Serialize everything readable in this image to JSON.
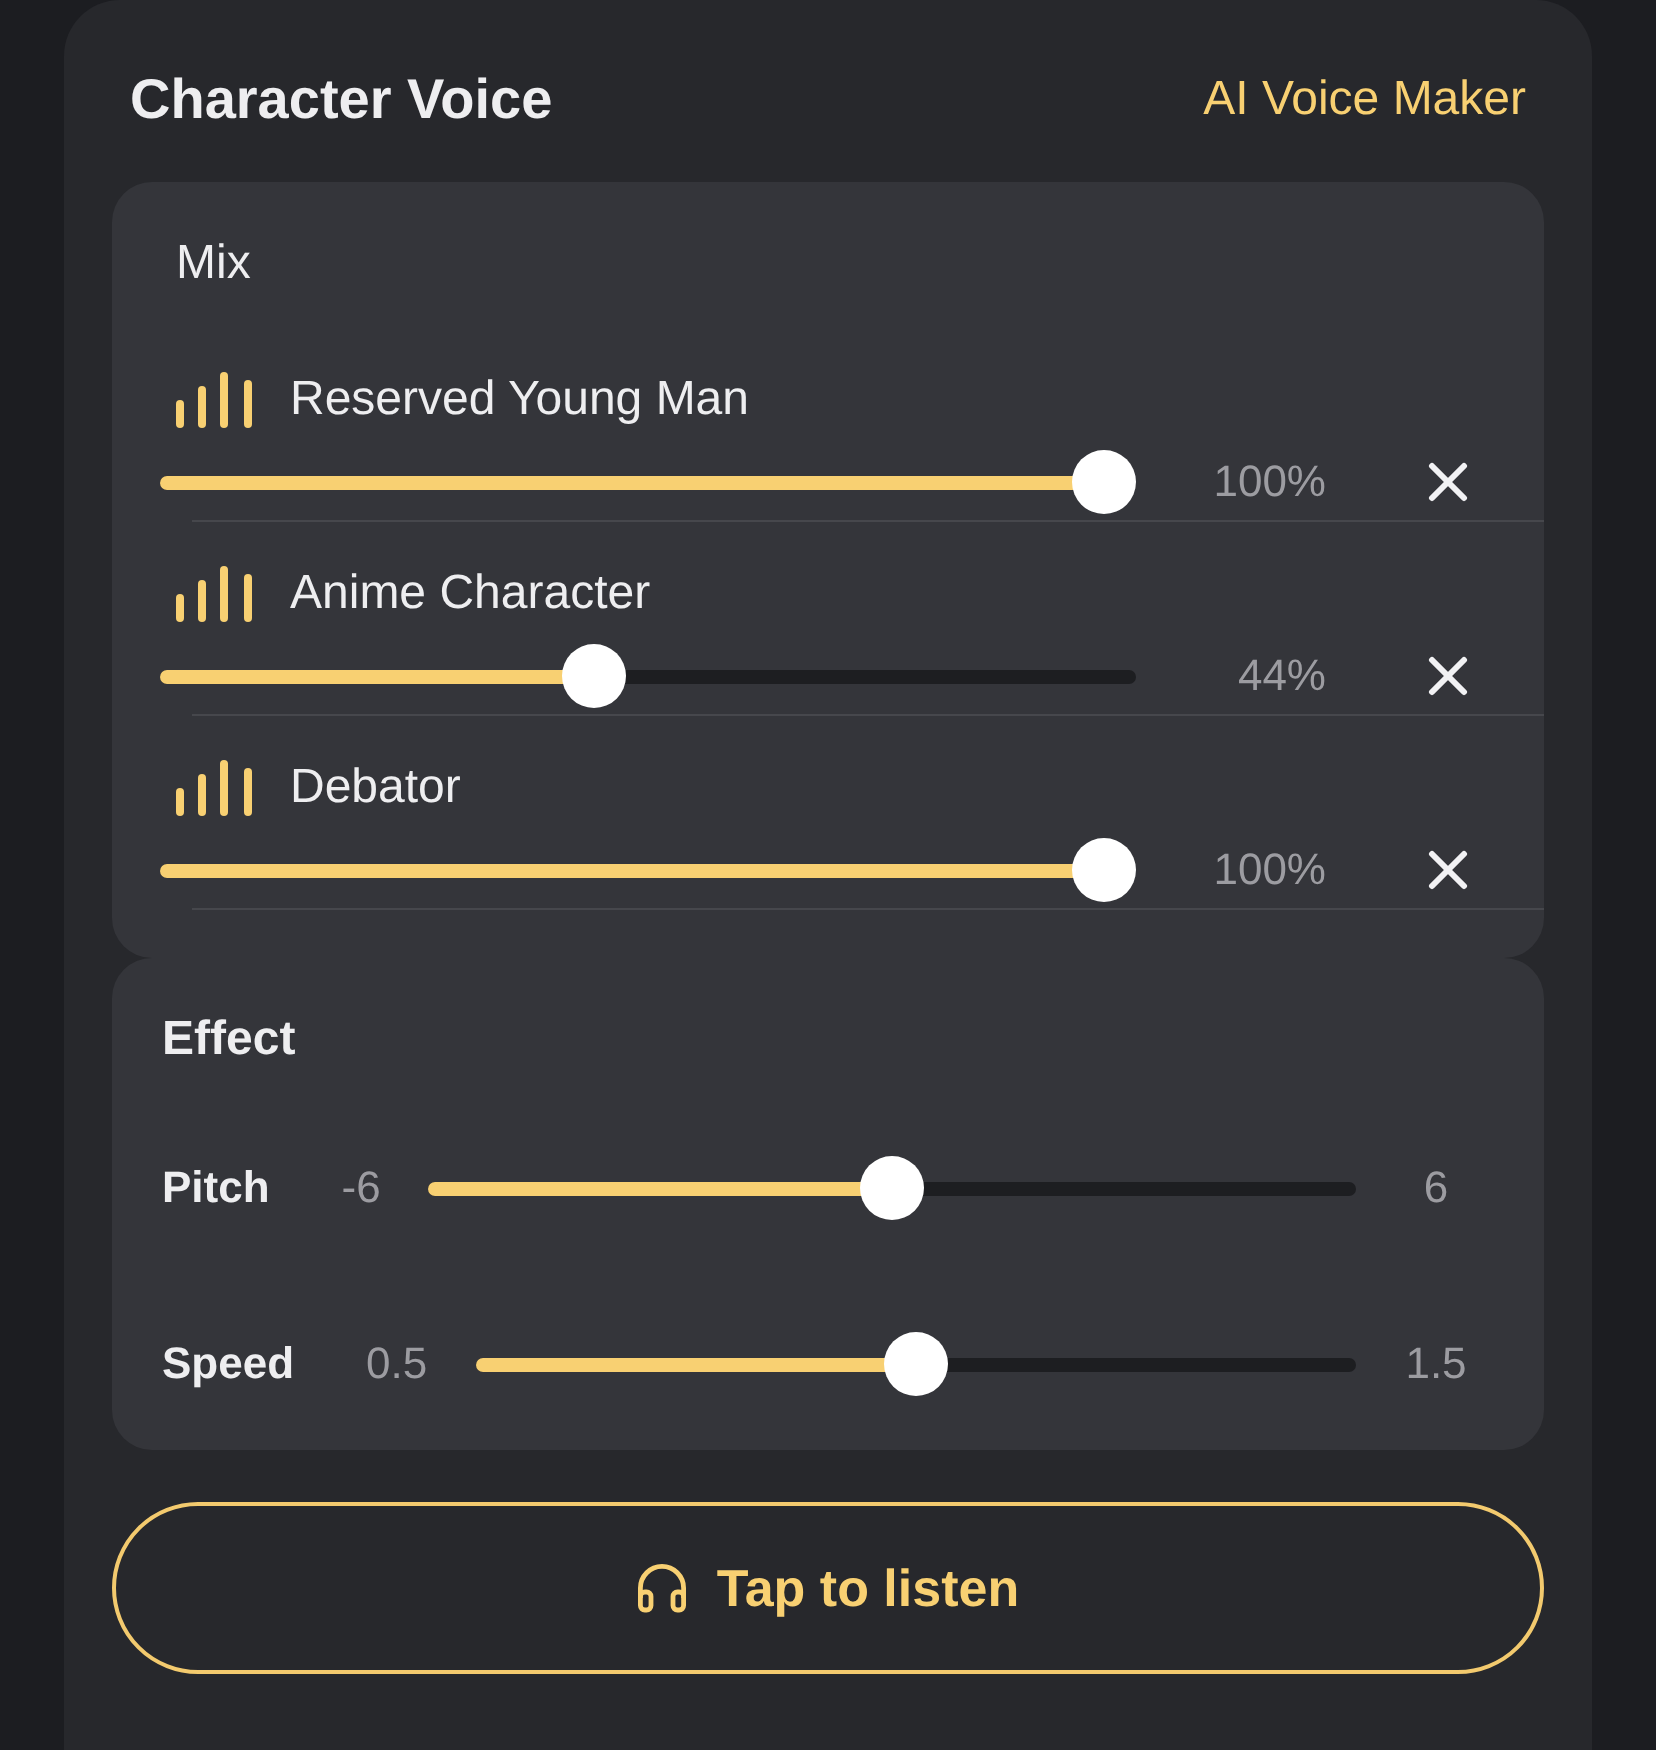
{
  "header": {
    "title": "Character Voice",
    "link": "AI Voice Maker"
  },
  "mix": {
    "title": "Mix",
    "voices": [
      {
        "name": "Reserved Young Man",
        "level": 1,
        "reading": "100%"
      },
      {
        "name": "Anime Character",
        "level": 0.44,
        "reading": "44%"
      },
      {
        "name": "Debator",
        "level": 1,
        "reading": "100%"
      }
    ]
  },
  "effect": {
    "title": "Effect",
    "sliders": [
      {
        "label": "Pitch",
        "min": "-6",
        "max": "6",
        "level": 0.5
      },
      {
        "label": "Speed",
        "min": "0.5",
        "max": "1.5",
        "level": 0.5
      }
    ]
  },
  "listen_button": {
    "label": "Tap to listen"
  }
}
